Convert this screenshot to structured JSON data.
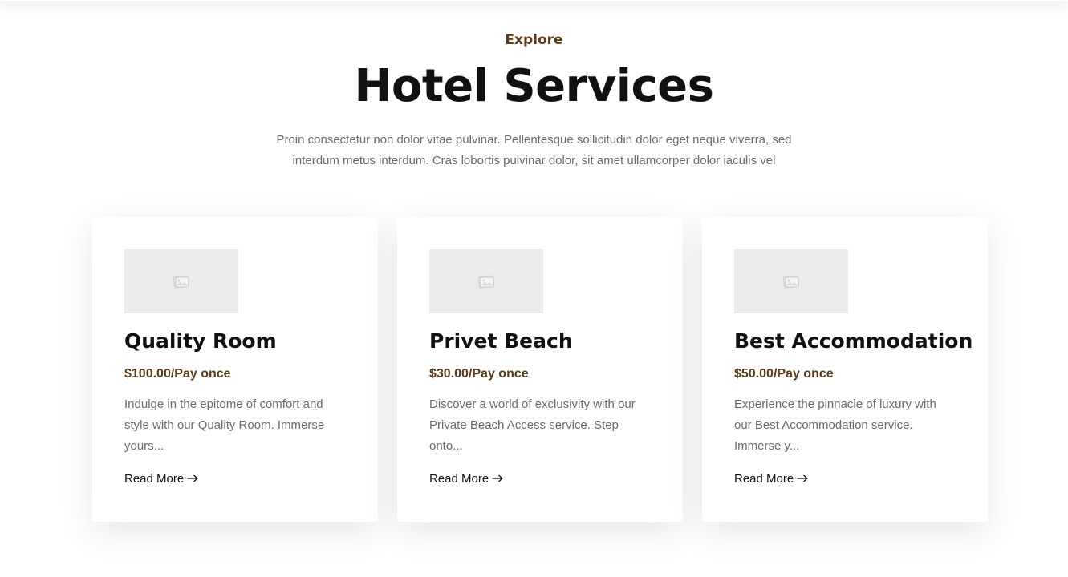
{
  "section": {
    "eyebrow": "Explore",
    "title": "Hotel Services",
    "subtitle": "Proin consectetur non dolor vitae pulvinar. Pellentesque sollicitudin dolor eget neque viverra, sed interdum metus interdum. Cras lobortis pulvinar dolor, sit amet ullamcorper dolor iaculis vel"
  },
  "colors": {
    "accent": "#5a3a1c",
    "heading": "#111111",
    "body_text": "#6b6b6b",
    "thumb_bg": "#ececec"
  },
  "cards": [
    {
      "icon": "image-placeholder-icon",
      "title": "Quality Room",
      "price": "$100.00/Pay once",
      "description": "Indulge in the epitome of comfort and style with our Quality Room. Immerse yours...",
      "link_label": "Read More",
      "link_icon": "arrow-right-icon"
    },
    {
      "icon": "image-placeholder-icon",
      "title": "Privet Beach",
      "price": "$30.00/Pay once",
      "description": "Discover a world of exclusivity with our Private Beach Access service. Step onto...",
      "link_label": "Read More",
      "link_icon": "arrow-right-icon"
    },
    {
      "icon": "image-placeholder-icon",
      "title": "Best Accommodation",
      "price": "$50.00/Pay once",
      "description": "Experience the pinnacle of luxury with our Best Accommodation service. Immerse y...",
      "link_label": "Read More",
      "link_icon": "arrow-right-icon"
    }
  ]
}
